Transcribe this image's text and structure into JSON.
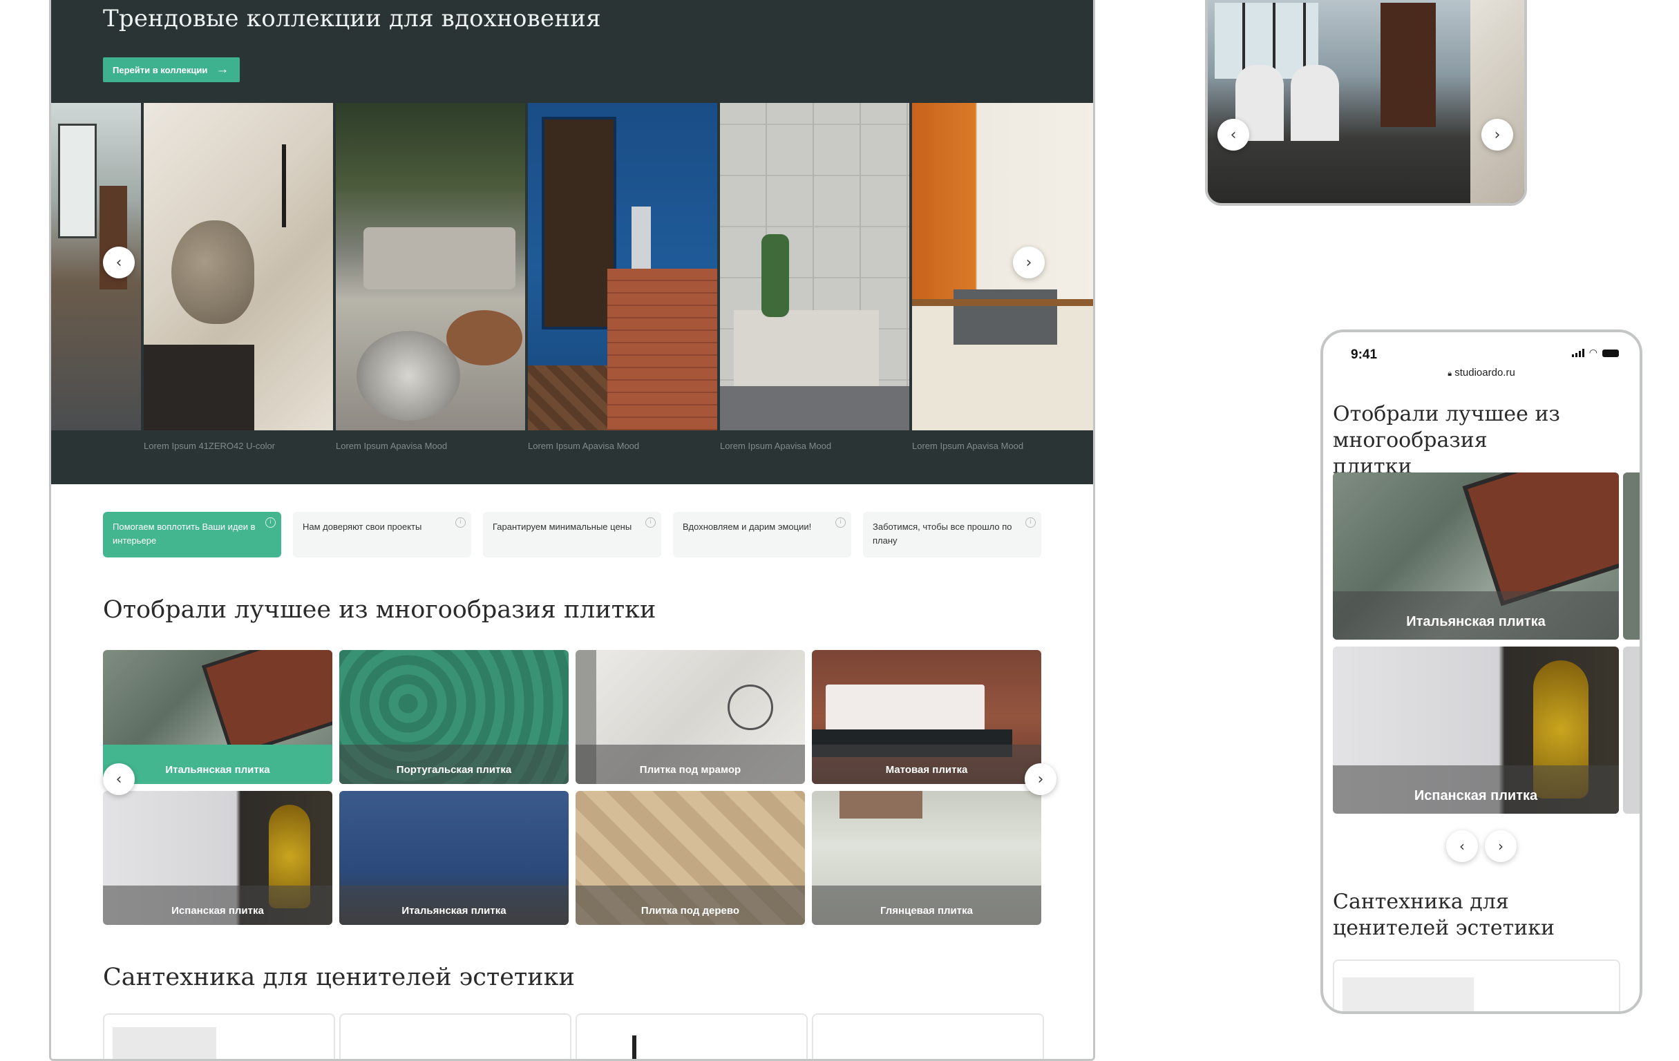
{
  "desktop": {
    "hero": {
      "title": "Трендовые коллекции для вдохновения",
      "button_label": "Перейти в коллекции",
      "captions": [
        "Lorem Ipsum 41ZERO42 U-color",
        "Lorem Ipsum Apavisa Mood",
        "Lorem Ipsum  Apavisa Mood",
        "Lorem Ipsum  Apavisa Mood",
        "Lorem Ipsum  Apavisa Mood"
      ],
      "prev_icon": "‹",
      "next_icon": "›"
    },
    "features": [
      "Помогаем воплотить Ваши идеи в интерьере",
      "Нам доверяют свои проекты",
      "Гарантируем минимальные цены",
      "Вдохновляем и дарим эмоции!",
      "Заботимся, чтобы все прошло по плану"
    ],
    "tiles_section": {
      "title": "Отобрали лучшее из многообразия плитки",
      "tiles": [
        "Итальянская плитка",
        "Португальская плитка",
        "Плитка под мрамор",
        "Матовая плитка",
        "Испанская плитка",
        "Итальянская плитка",
        "Плитка под дерево",
        "Глянцевая плитка"
      ]
    },
    "plumbing_section": {
      "title": "Сантехника для ценителей эстетики"
    }
  },
  "phone": {
    "time": "9:41",
    "url": "studioardo.ru",
    "tiles_title": "Отобрали лучшее из многообразия плитки",
    "tiles": [
      "Итальянская плитка",
      "Испанская плитка"
    ],
    "plumbing_title": "Сантехника для ценителей эстетики"
  },
  "colors": {
    "accent": "#43b68f",
    "hero_bg": "#2a3434"
  }
}
